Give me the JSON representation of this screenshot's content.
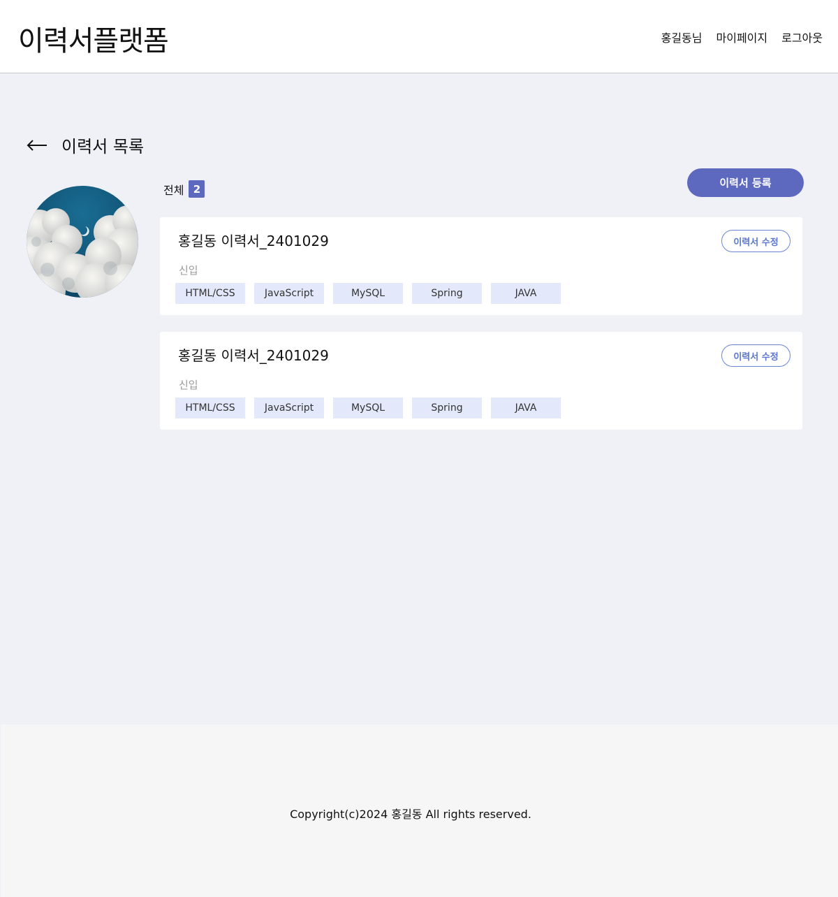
{
  "header": {
    "logo": "이력서플랫폼",
    "nav": {
      "user": "홍길동님",
      "mypage": "마이페이지",
      "logout": "로그아웃"
    }
  },
  "page": {
    "title": "이력서 목록",
    "total_label": "전체",
    "total_count": "2",
    "register_label": "이력서 등록"
  },
  "resumes": [
    {
      "title": "홍길동 이력서_2401029",
      "edit_label": "이력서 수정",
      "level": "신입",
      "tags": [
        "HTML/CSS",
        "JavaScript",
        "MySQL",
        "Spring",
        "JAVA"
      ]
    },
    {
      "title": "홍길동 이력서_2401029",
      "edit_label": "이력서 수정",
      "level": "신입",
      "tags": [
        "HTML/CSS",
        "JavaScript",
        "MySQL",
        "Spring",
        "JAVA"
      ]
    }
  ],
  "footer": {
    "copyright": "Copyright(c)2024 홍길동 All rights reserved."
  },
  "colors": {
    "accent": "#5d68bf",
    "edit_border": "#6b85d6",
    "tag_bg": "#e3e9fb",
    "page_bg": "#f0f1f6"
  }
}
